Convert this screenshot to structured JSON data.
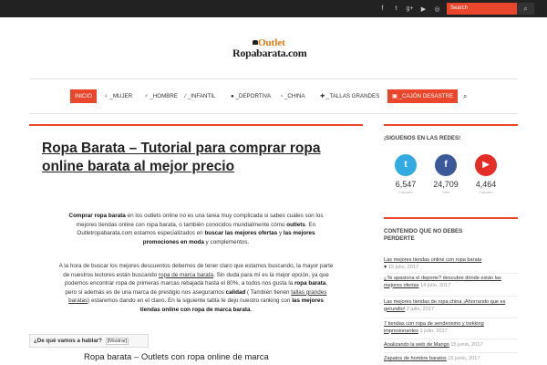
{
  "topbar": {
    "social_icons": [
      "facebook-icon",
      "twitter-icon",
      "google-plus-icon",
      "youtube-icon",
      "instagram-icon"
    ],
    "search_placeholder": "Search",
    "colors": {
      "bar": "#222222",
      "search": "#e9462b"
    }
  },
  "logo": {
    "line1": "Outlet",
    "line2": "Ropabarata.com"
  },
  "nav": {
    "items": [
      "INICIO",
      "_MUJER",
      "_HOMBRE",
      "_INFANTIL",
      "_DEPORTIVA",
      "_CHINA",
      "_TALLAS GRANDES",
      "_CAJÓN DESASTRE"
    ],
    "active": "INICIO"
  },
  "article": {
    "title": "Ropa Barata – Tutorial para comprar ropa online barata al mejor precio",
    "toc_label": "¿De qué vamos a hablar?",
    "toc_toggle": "[Mostrar]",
    "subheading": "Ropa barata –  Outlets con ropa online de marca"
  },
  "sidebar": {
    "social_heading": "¡SIGUENOS EN LAS REDES!",
    "social": [
      {
        "icon": "twitter-icon",
        "count": "6,547",
        "label": "Followers",
        "color": "#33aae1"
      },
      {
        "icon": "facebook-icon",
        "count": "24,709",
        "label": "Fans",
        "color": "#3b5998"
      },
      {
        "icon": "youtube-icon",
        "count": "4,464",
        "label": "Followers",
        "color": "#e52d27"
      }
    ],
    "posts_heading_1": "CONTENIDO QUE NO DEBES",
    "posts_heading_2": "PERDERTE",
    "posts": [
      {
        "title": "Las mejores tiendas online con ropa barata",
        "heart": "♥",
        "date": "15 julio, 2017"
      },
      {
        "title": "¿Te apasiona el deporte? descubre dónde están las mejores ofertas",
        "date": "14 julio, 2017"
      },
      {
        "title": "Las mejores tiendas de ropa china ¡Ahorrando que es gerundio!",
        "date": "2 julio, 2017"
      },
      {
        "title": "7 tiendas con ropa de senderismo y trekking impresionantes",
        "date": "1 julio, 2017"
      },
      {
        "title": "Analizando la web de Mango",
        "date": "15 junio, 2017"
      },
      {
        "title": "Zapatos de hombre baratos",
        "date": "15 junio, 2017"
      }
    ]
  }
}
